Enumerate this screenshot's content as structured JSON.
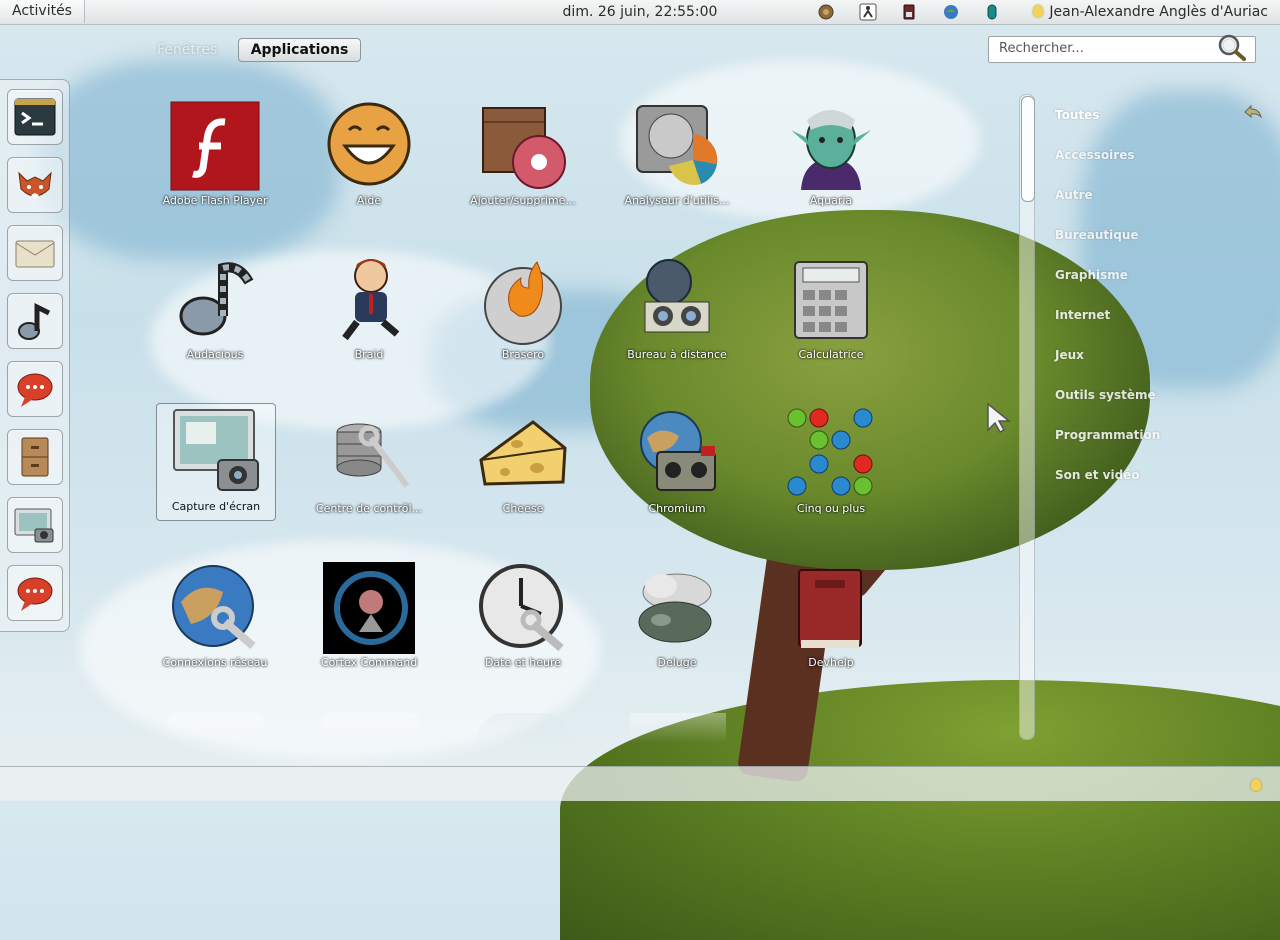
{
  "topbar": {
    "activities": "Activités",
    "clock": "dim. 26 juin, 22:55:00",
    "user": "Jean-Alexandre Anglès d'Auriac"
  },
  "view_tabs": [
    {
      "label": "Fenêtres",
      "active": false
    },
    {
      "label": "Applications",
      "active": true
    }
  ],
  "search": {
    "placeholder": "Rechercher...",
    "value": ""
  },
  "dash": [
    {
      "name": "terminal-icon"
    },
    {
      "name": "firefox-icon"
    },
    {
      "name": "mail-icon"
    },
    {
      "name": "audacious-icon"
    },
    {
      "name": "chat-icon"
    },
    {
      "name": "file-cabinet-icon"
    },
    {
      "name": "screenshot-icon"
    },
    {
      "name": "chat-icon"
    }
  ],
  "apps": [
    {
      "label": "Adobe Flash Player",
      "icon": "flash-icon"
    },
    {
      "label": "Aide",
      "icon": "help-face-icon"
    },
    {
      "label": "Ajouter/supprime...",
      "icon": "package-icon"
    },
    {
      "label": "Analyseur d'utilis...",
      "icon": "disk-usage-icon"
    },
    {
      "label": "Aquaria",
      "icon": "aquaria-icon"
    },
    {
      "label": "Audacious",
      "icon": "audacious-icon"
    },
    {
      "label": "Braid",
      "icon": "braid-icon"
    },
    {
      "label": "Brasero",
      "icon": "brasero-icon"
    },
    {
      "label": "Bureau à distance",
      "icon": "remote-desktop-icon"
    },
    {
      "label": "Calculatrice",
      "icon": "calculator-icon"
    },
    {
      "label": "Capture d'écran",
      "icon": "screenshot-icon",
      "selected": true
    },
    {
      "label": "Centre de contrôl...",
      "icon": "control-center-icon"
    },
    {
      "label": "Cheese",
      "icon": "cheese-icon"
    },
    {
      "label": "Chromium",
      "icon": "chromium-icon"
    },
    {
      "label": "Cinq ou plus",
      "icon": "five-or-more-icon"
    },
    {
      "label": "Connexions réseau",
      "icon": "network-icon"
    },
    {
      "label": "Cortex Command",
      "icon": "cortex-command-icon"
    },
    {
      "label": "Date et heure",
      "icon": "clock-icon"
    },
    {
      "label": "Deluge",
      "icon": "deluge-icon"
    },
    {
      "label": "Devhelp",
      "icon": "devhelp-icon"
    }
  ],
  "categories": [
    "Toutes",
    "Accessoires",
    "Autre",
    "Bureautique",
    "Graphisme",
    "Internet",
    "Jeux",
    "Outils système",
    "Programmation",
    "Son et vidéo"
  ],
  "colors": {
    "flash_red": "#b2161d",
    "topbar": "#e6e9ea",
    "canopy": "#6a8a2c"
  }
}
